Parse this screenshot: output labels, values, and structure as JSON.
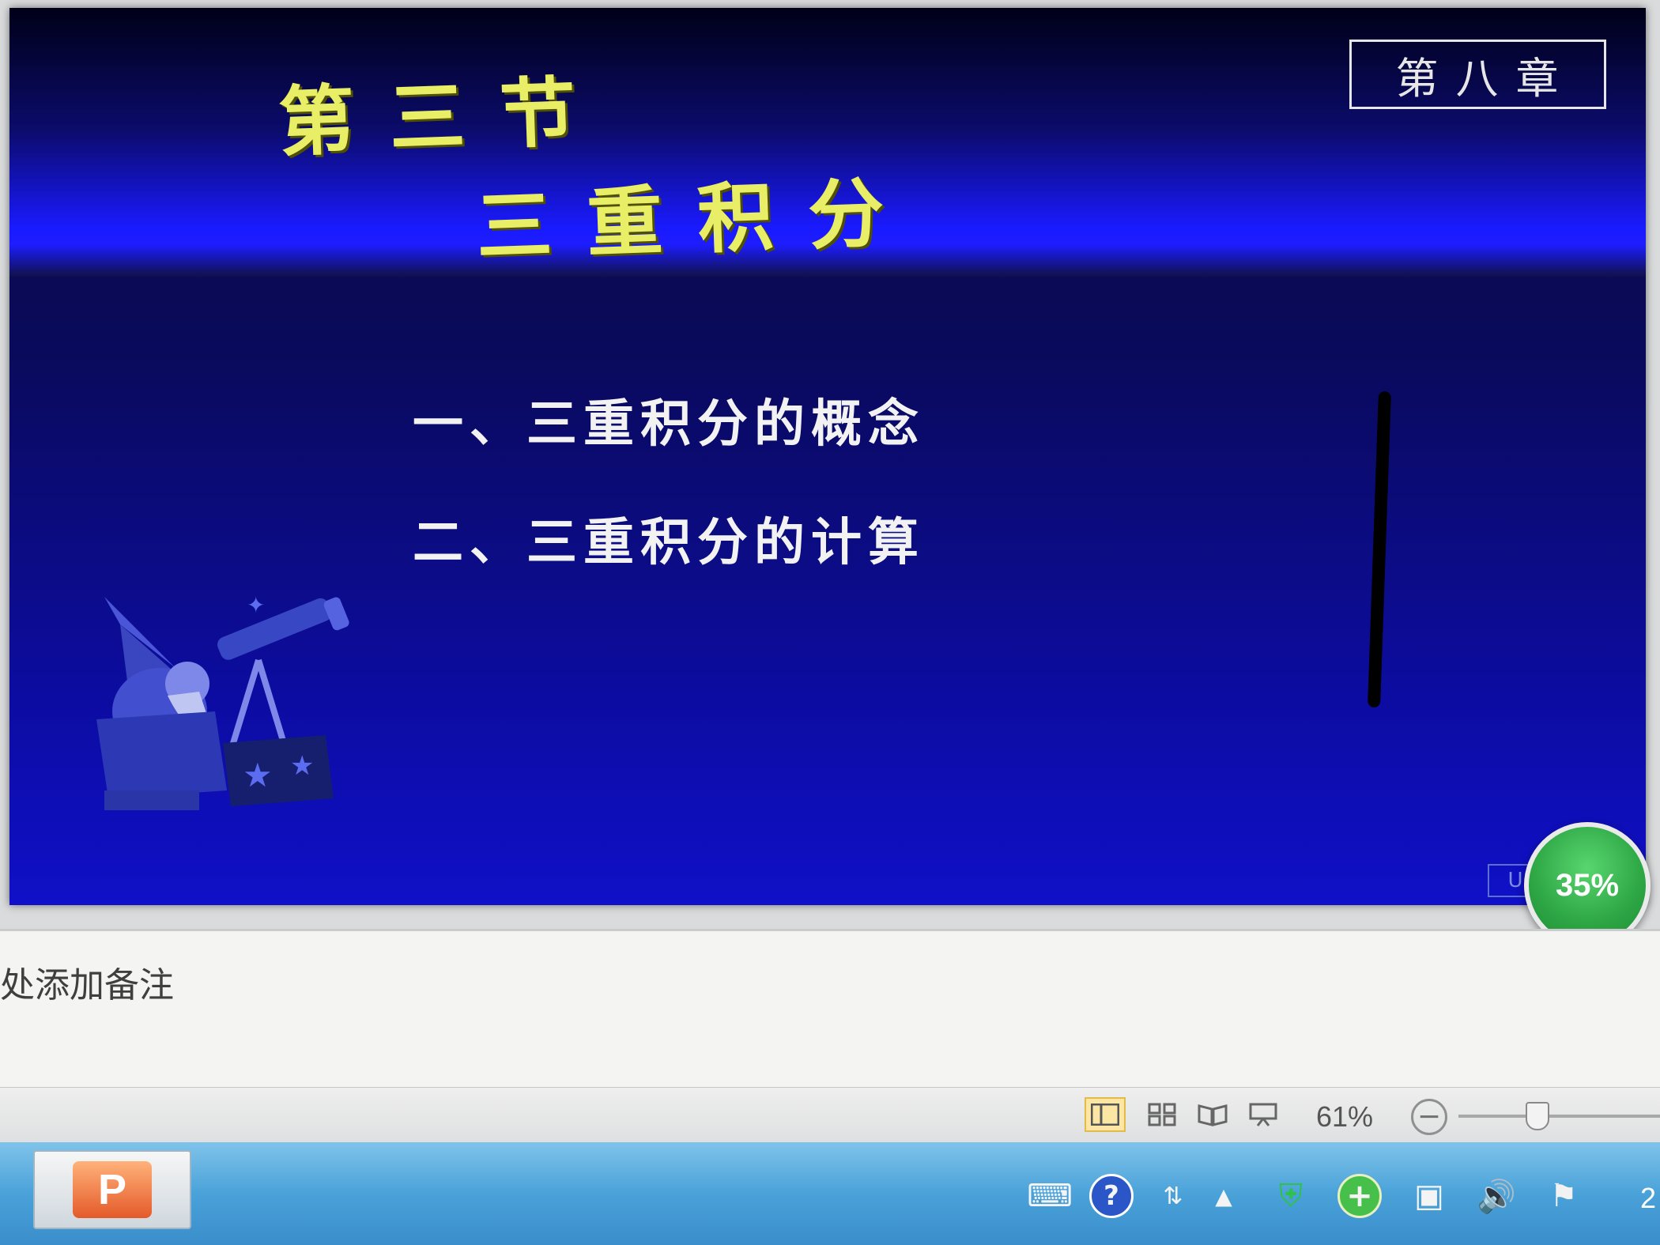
{
  "slide": {
    "title_line1": "第三节",
    "title_line2": "三重积分",
    "chapter_label": "第八章",
    "items": [
      "一、三重积分的概念",
      "二、三重积分的计算"
    ]
  },
  "overlay": {
    "progress_badge": "35%",
    "progress_value": 35
  },
  "notes": {
    "placeholder_text": "处添加备注"
  },
  "statusbar": {
    "zoom_level": "61%",
    "zoom_out_symbol": "−",
    "active_view": "normal-view"
  },
  "taskbar": {
    "app": "PowerPoint",
    "app_icon_letter": "P",
    "clock_fragment": "2"
  },
  "colors": {
    "title": "#e8ee66",
    "slide_bg": "#0a0a5e",
    "badge": "#2fa846",
    "taskbar": "#4aa2d9"
  }
}
